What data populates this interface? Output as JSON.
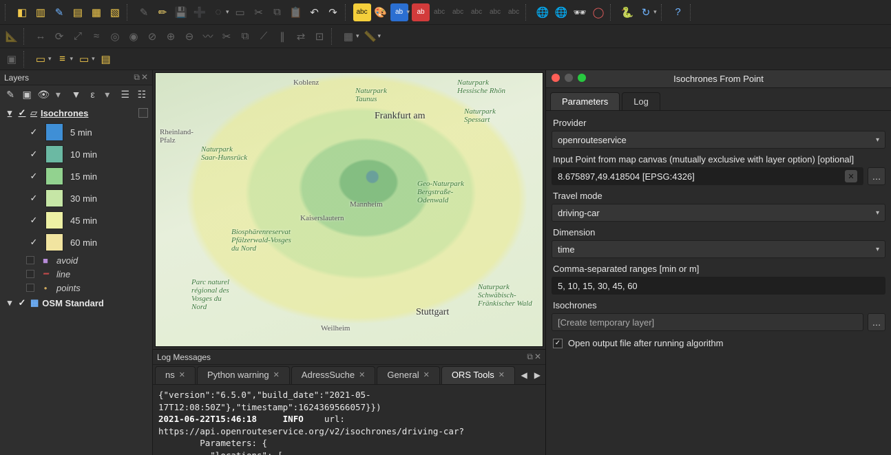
{
  "layers_panel": {
    "title": "Layers",
    "root_group": "Isochrones",
    "legend": [
      {
        "label": "5 min",
        "color": "#3f8fd6"
      },
      {
        "label": "10 min",
        "color": "#6bb9a3"
      },
      {
        "label": "15 min",
        "color": "#92d28f"
      },
      {
        "label": "30 min",
        "color": "#c6e6a6"
      },
      {
        "label": "45 min",
        "color": "#edf0a4"
      },
      {
        "label": "60 min",
        "color": "#f1e4a0"
      }
    ],
    "sublayers": [
      {
        "name": "avoid",
        "sym": "■",
        "color": "#b78bd8"
      },
      {
        "name": "line",
        "sym": "─",
        "color": "#c24a4a"
      },
      {
        "name": "points",
        "sym": "·",
        "color": "#cfa95e"
      }
    ],
    "base_layer": "OSM Standard"
  },
  "map_labels": {
    "koblenz": "Koblenz",
    "frankfurt": "Frankfurt am",
    "mannheim": "Mannheim",
    "stuttgart": "Stuttgart",
    "kaiserslautern": "Kaiserslautern",
    "rheinland": "Rheinland-\nPfalz",
    "saarwald": "Naturpark\nSaar-Hunsrück",
    "pfalzerwald": "Biosphärenreservat\nPfälzerwald-Vosges\ndu Nord",
    "vosges": "Parc naturel\nrégional des\nVosges du\nNord",
    "spessart": "Naturpark\nSpessart",
    "rhon": "Naturpark\nHessische Rhön",
    "taunus": "Naturpark\nTaunus",
    "neckar_odenw": "Geo-Naturpark\nBergstraße-\nOdenwald",
    "hohenlohe": "Naturpark\nSchwäbisch-\nFränkischer Wald",
    "weilheim": "Weilheim"
  },
  "log_panel": {
    "title": "Log Messages",
    "tabs": [
      "ns",
      "Python warning",
      "AdressSuche",
      "General",
      "ORS Tools"
    ],
    "active_tab": 4,
    "line1_a": "{\"version\":\"6.5.0\",\"build_date\":\"2021-05-17T12:08:50Z\"},\"timestamp\":1624369566057}})",
    "line2_ts": "2021-06-22T15:46:18",
    "line2_level": "INFO",
    "line2_msg": "url: https://api.openrouteservice.org/v2/isochrones/driving-car?",
    "line3": "        Parameters: {",
    "line4": "          \"locations\": ["
  },
  "tool_panel": {
    "title": "Isochrones From Point",
    "tabs": [
      "Parameters",
      "Log"
    ],
    "active_tab": 0,
    "fields": {
      "provider_label": "Provider",
      "provider_value": "openrouteservice",
      "input_point_label": "Input Point from map canvas (mutually exclusive with layer option) [optional]",
      "input_point_value": "8.675897,49.418504 [EPSG:4326]",
      "travel_mode_label": "Travel mode",
      "travel_mode_value": "driving-car",
      "dimension_label": "Dimension",
      "dimension_value": "time",
      "ranges_label": "Comma-separated ranges [min or m]",
      "ranges_value": "5, 10, 15, 30, 45, 60",
      "output_label": "Isochrones",
      "output_placeholder": "[Create temporary layer]",
      "open_after_label": "Open output file after running algorithm"
    },
    "open_after_checked": true
  }
}
